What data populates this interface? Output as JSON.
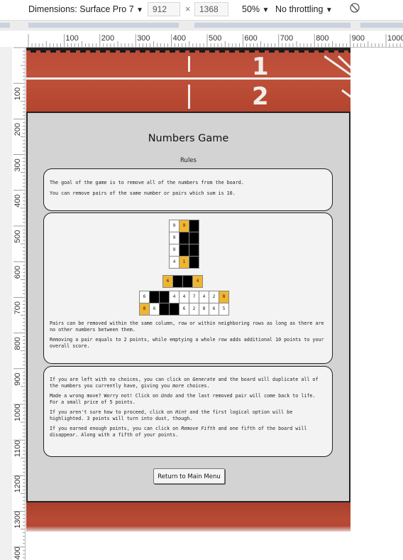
{
  "devtools": {
    "dimensions_label": "Dimensions: Surface Pro 7",
    "width": "912",
    "height": "1368",
    "zoom": "50%",
    "throttling": "No throttling"
  },
  "rulers": {
    "horizontal": [
      "100",
      "200",
      "300",
      "400",
      "500",
      "600",
      "700",
      "800",
      "900",
      "1000"
    ],
    "vertical": [
      "100",
      "200",
      "300",
      "400",
      "500",
      "600",
      "700",
      "800",
      "900",
      "1000",
      "1100",
      "1200",
      "1300",
      "1400"
    ]
  },
  "track": {
    "lane_numbers": [
      "1",
      "2"
    ]
  },
  "game": {
    "title": "Numbers Game",
    "subtitle": "Rules",
    "intro": [
      "The goal of the game is to remove all of the numbers from the board.",
      "You can remove pairs of the same number or pairs which sum is 10."
    ],
    "example_grid_vertical": [
      [
        "9",
        "9",
        ""
      ],
      [
        "9",
        "",
        ""
      ],
      [
        "9",
        "",
        ""
      ],
      [
        "4",
        "1",
        ""
      ]
    ],
    "example_row_pair": [
      "6",
      "",
      "",
      "4"
    ],
    "example_grid_wide": [
      [
        "6",
        "",
        "",
        "4",
        "4",
        "7",
        "4",
        "2",
        "8"
      ],
      [
        "8",
        "6",
        "",
        "",
        "6",
        "2",
        "8",
        "6",
        "5"
      ]
    ],
    "pairs_rules": [
      "Pairs can be removed within the same column, row or within neighboring rows as long as there are no other numbers between them.",
      "Removing a pair equals to 2 points, while emptying a whole row adds additional 10 points to your overall score."
    ],
    "help": {
      "generate_pre": "If you are left with no choices, you can click on ",
      "generate_word": "Generate",
      "generate_mid": " and the board will duplicate all of the numbers you currently have, giving you ",
      "generate_em": "more",
      "generate_post": " choices.",
      "undo_pre": "Made a wrong move? Worry not! Click on ",
      "undo_word": "Undo",
      "undo_post": " and the last removed pair will come back to life. For a small price of 5 points.",
      "hint_pre": "If you aren't sure how to proceed, click on ",
      "hint_word": "Hint",
      "hint_post": " and the first logical option will be highlighted. 3 points will turn into dust, though.",
      "fifth_pre": "If you earned enough points, you can click on ",
      "fifth_word": "Remove Fifth",
      "fifth_post": " and one fifth of the board will disappear. Along with a fifth of your points."
    },
    "return_button": "Return to Main Menu"
  },
  "colors": {
    "highlight": "#f0b530",
    "blocked": "#000000",
    "panel": "#d3d3d3"
  }
}
